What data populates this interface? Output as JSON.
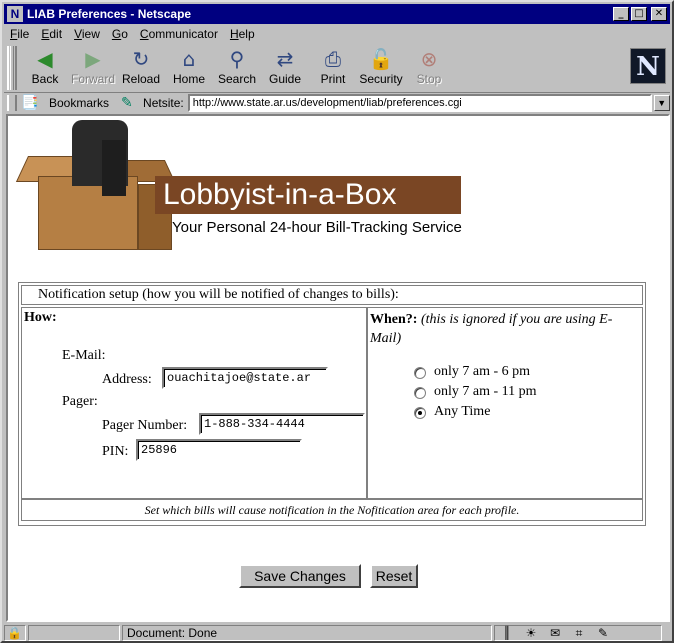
{
  "window": {
    "title": "LIAB Preferences - Netscape",
    "controls": {
      "minimize": "_",
      "maximize": "□",
      "close": "✕"
    }
  },
  "menubar": [
    "File",
    "Edit",
    "View",
    "Go",
    "Communicator",
    "Help"
  ],
  "toolbar": [
    {
      "label": "Back",
      "icon": "back-arrow-icon",
      "glyph": "◀",
      "color": "#2c8a2c",
      "enabled": true
    },
    {
      "label": "Forward",
      "icon": "forward-arrow-icon",
      "glyph": "▶",
      "color": "#2c8a2c",
      "enabled": false
    },
    {
      "label": "Reload",
      "icon": "reload-icon",
      "glyph": "↻",
      "color": "#304880",
      "enabled": true
    },
    {
      "label": "Home",
      "icon": "home-icon",
      "glyph": "⌂",
      "color": "#304880",
      "enabled": true
    },
    {
      "label": "Search",
      "icon": "search-icon",
      "glyph": "⚲",
      "color": "#304880",
      "enabled": true
    },
    {
      "label": "Guide",
      "icon": "guide-icon",
      "glyph": "⇄",
      "color": "#304880",
      "enabled": true
    },
    {
      "label": "Print",
      "icon": "print-icon",
      "glyph": "⎙",
      "color": "#304880",
      "enabled": true
    },
    {
      "label": "Security",
      "icon": "lock-icon",
      "glyph": "🔓",
      "color": "#a03020",
      "enabled": true
    },
    {
      "label": "Stop",
      "icon": "stop-icon",
      "glyph": "⊗",
      "color": "#a03020",
      "enabled": false
    }
  ],
  "brand_logo": "N",
  "location": {
    "bookmarks_label": "Bookmarks",
    "netsite_label": "Netsite:",
    "url": "http://www.state.ar.us/development/liab/preferences.cgi"
  },
  "banner": {
    "title": "Lobbyist-in-a-Box",
    "tagline": "Your Personal 24-hour Bill-Tracking Service"
  },
  "form": {
    "section_header": "Notification setup (how you will be notified of changes to bills):",
    "how_label": "How:",
    "email_label": "E-Mail:",
    "address_label": "Address:",
    "address_value": "ouachitajoe@state.ar",
    "pager_label": "Pager:",
    "pager_number_label": "Pager Number:",
    "pager_number_value": "1-888-334-4444",
    "pin_label": "PIN:",
    "pin_value": "25896",
    "when_label": "When?:",
    "when_note": "(this is ignored if you are using E-Mail)",
    "when_options": [
      {
        "label": "only 7 am - 6 pm",
        "checked": false
      },
      {
        "label": "only 7 am - 11 pm",
        "checked": false
      },
      {
        "label": "Any Time",
        "checked": true
      }
    ],
    "footer_note": "Set which bills will cause notification in the Nofitication area for each profile.",
    "save_button": "Save Changes",
    "reset_button": "Reset"
  },
  "status": {
    "text": "Document: Done"
  }
}
